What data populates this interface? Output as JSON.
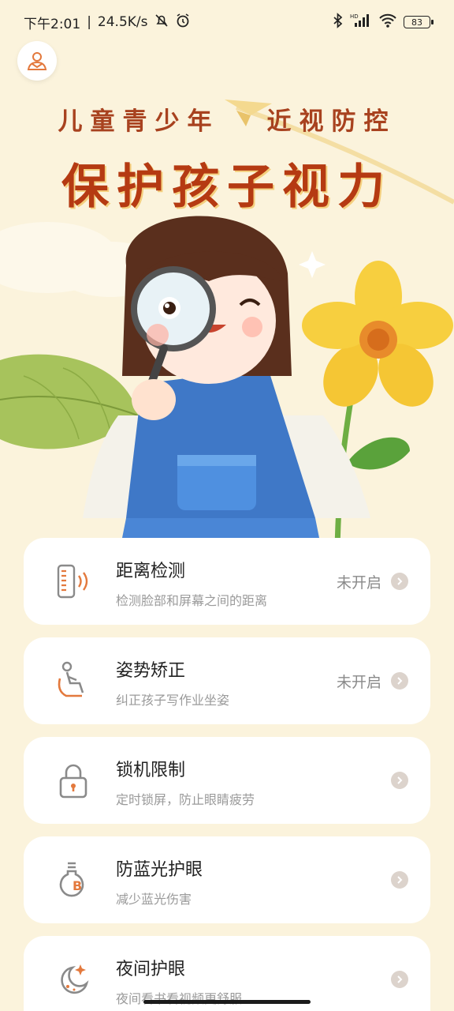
{
  "status_bar": {
    "time": "下午2:01",
    "speed": "24.5K/s",
    "battery": "83",
    "icons": [
      "mute-bell-icon",
      "alarm-icon",
      "bluetooth-icon",
      "signal-icon",
      "wifi-icon",
      "battery-icon"
    ]
  },
  "header": {
    "subtitle_left": "儿童青少年",
    "subtitle_right": "近视防控",
    "title": "保护孩子视力"
  },
  "cards": [
    {
      "title": "距离检测",
      "sub": "检测脸部和屏幕之间的距离",
      "status": "未开启",
      "icon": "distance-phone-icon"
    },
    {
      "title": "姿势矫正",
      "sub": "纠正孩子写作业坐姿",
      "status": "未开启",
      "icon": "posture-icon"
    },
    {
      "title": "锁机限制",
      "sub": "定时锁屏，防止眼睛疲劳",
      "status": "",
      "icon": "lock-icon"
    },
    {
      "title": "防蓝光护眼",
      "sub": "减少蓝光伤害",
      "status": "",
      "icon": "blue-light-bulb-icon"
    },
    {
      "title": "夜间护眼",
      "sub": "夜间看书看视频更舒服",
      "status": "",
      "icon": "night-moon-icon"
    }
  ],
  "colors": {
    "background": "#fbf3dc",
    "accent": "#e3793d",
    "title": "#b53a12"
  }
}
